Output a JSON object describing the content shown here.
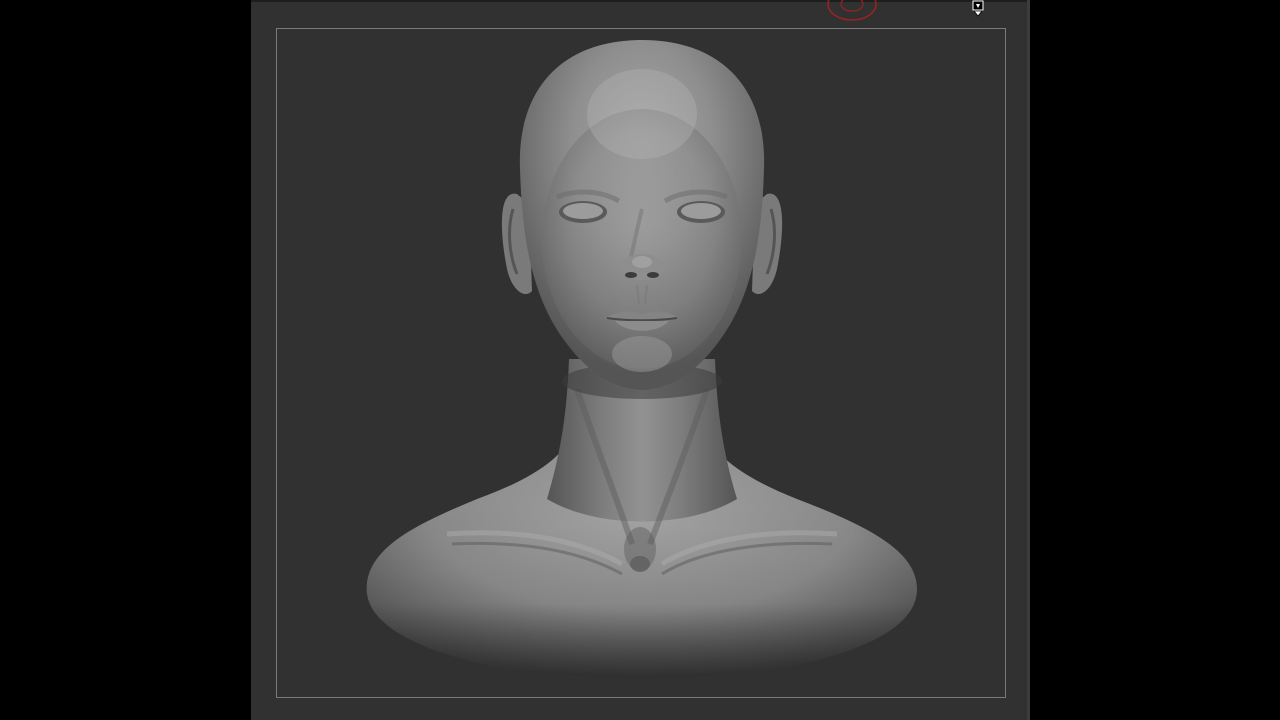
{
  "app": {
    "name": "sculpting-viewport"
  },
  "viewport": {
    "background_color": "#313131",
    "frame_border_color": "#7a7a7a",
    "model": {
      "description_icon": "sculpted-head-bust",
      "material_color": "#8a8a8a"
    }
  },
  "cursor": {
    "brush_color": "#b02020",
    "pointer_icon": "mouse-pointer-icon"
  }
}
